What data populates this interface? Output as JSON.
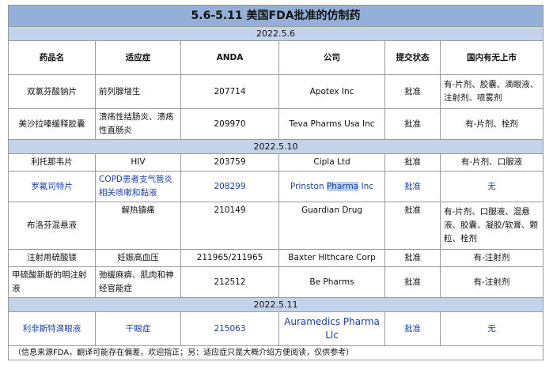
{
  "title": "5.6-5.11 美国FDA批准的仿制药",
  "headers": [
    "药品名",
    "适应症",
    "ANDA",
    "公司",
    "提交状态",
    "国内有无上市"
  ],
  "groups": [
    {
      "date": "2022.5.6",
      "rows": [
        {
          "drug": "双氯芬酸钠片",
          "indication": "前列腺增生",
          "anda": "207714",
          "company": "Apotex Inc",
          "status": "批准",
          "domestic": "有-片剂、胶囊、滴眼液、注射剂、喷雾剂",
          "blue": false
        },
        {
          "drug": "美沙拉嗪缓释胶囊",
          "indication": "溃疡性结肠炎、溃疡性直肠炎",
          "anda": "209970",
          "company": "Teva Pharms Usa Inc",
          "status": "批准",
          "domestic": "有-片剂、栓剂",
          "blue": false
        }
      ]
    },
    {
      "date": "2022.5.10",
      "rows": [
        {
          "drug": "利托那韦片",
          "indication": "HIV",
          "anda": "203759",
          "company": "Cipla Ltd",
          "status": "批准",
          "domestic": "有-片剂、口服液",
          "blue": false
        },
        {
          "drug": "罗氟司特片",
          "indication": "COPD患者支气管炎相关咳嗽和黏液",
          "anda": "208299",
          "company_pre": "Prinston ",
          "company_hl": "Pharma",
          "company_post": " Inc",
          "status": "批准",
          "domestic": "无",
          "blue": true
        },
        {
          "drug": "布洛芬混悬液",
          "indication": "解热镇痛",
          "anda": "210149",
          "company": "Guardian Drug",
          "status": "批准",
          "domestic": "有-片剂、口服液、混悬液、胶囊、凝胶/软膏、颗粒、栓剂",
          "blue": false
        },
        {
          "drug": "注射用硫酸镁",
          "indication": "妊娠高血压",
          "anda": "211965/211965",
          "company": "Baxter Hlthcare Corp",
          "status": "批准",
          "domestic": "有-注射剂",
          "blue": false
        },
        {
          "drug": "甲硫酸新斯的明注射液",
          "indication": "弛缓麻痹、肌肉和神经官能症",
          "anda": "212512",
          "company": "Be Pharms",
          "status": "批准",
          "domestic": "有-注射剂",
          "blue": false
        }
      ]
    },
    {
      "date": "2022.5.11",
      "rows": [
        {
          "drug": "利非斯特滴眼液",
          "indication": "干眼症",
          "anda": "215063",
          "company": "Auramedics Pharma Llc",
          "status": "批准",
          "domestic": "无",
          "blue": true
        }
      ]
    }
  ],
  "note": "（信息来源FDA，翻译可能存在偏差，欢迎指正；另：适应症只是大概介绍方便阅读，仅供参考）"
}
